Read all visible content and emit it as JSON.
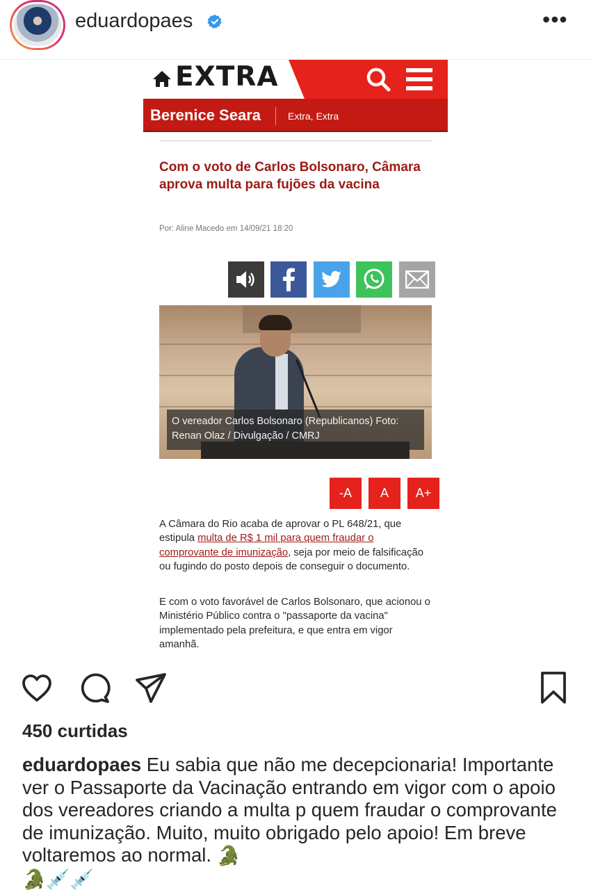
{
  "header": {
    "username": "eduardopaes",
    "verified_icon": "verified-badge-icon",
    "more_icon": "more-options-icon",
    "more_label": "•••"
  },
  "article": {
    "logo": "EXTRA",
    "columnist": "Berenice Seara",
    "section": "Extra, Extra",
    "headline": "Com o voto de Carlos Bolsonaro, Câmara aprova multa para fujões da vacina",
    "byline": "Por: Aline Macedo em 14/09/21 18:20",
    "share_buttons": [
      "audio",
      "facebook",
      "twitter",
      "whatsapp",
      "email"
    ],
    "photo_caption": "O vereador Carlos Bolsonaro (Republicanos) Foto: Renan Olaz / Divulgação / CMRJ",
    "font_buttons": [
      "-A",
      "A",
      "A+"
    ],
    "paragraph1_before": "A Câmara do Rio acaba de aprovar o PL 648/21, que estipula ",
    "paragraph1_link": "multa de R$ 1 mil para quem fraudar o comprovante de imunização",
    "paragraph1_after": ", seja por meio de falsificação ou fugindo do posto depois de conseguir o documento.",
    "paragraph2": "E com o voto favorável de Carlos Bolsonaro, que acionou o Ministério Público contra o \"passaporte da vacina\" implementado pela prefeitura, e que entra em vigor amanhã.",
    "colors": {
      "brand_red": "#e5221b",
      "dark_red": "#c41a14",
      "headline": "#9b1b15"
    }
  },
  "actions": {
    "icons": [
      "heart-icon",
      "comment-icon",
      "share-icon",
      "bookmark-icon"
    ]
  },
  "post": {
    "likes": "450 curtidas",
    "caption_user": "eduardopaes",
    "caption_text": " Eu sabia que não me decepcionaria! Importante ver o Passaporte da Vacinação entrando em vigor com o apoio dos vereadores criando a  multa p quem fraudar o comprovante de imunização.  Muito, muito obrigado pelo apoio! Em breve voltaremos ao normal. ",
    "emojis": [
      "🐊",
      "🐊",
      "💉",
      "💉"
    ]
  }
}
